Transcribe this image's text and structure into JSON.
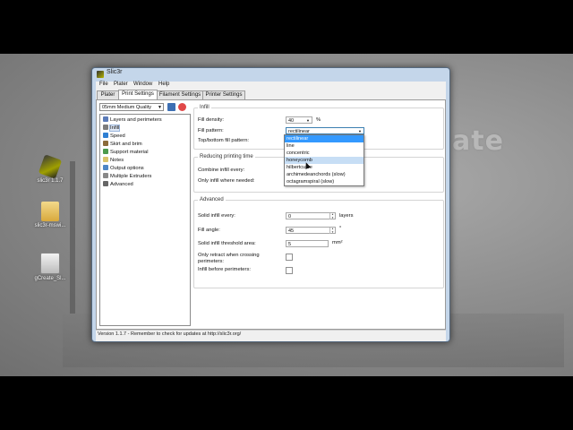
{
  "window": {
    "title": "Slic3r",
    "menu": [
      "File",
      "Plater",
      "Window",
      "Help"
    ],
    "tabs": [
      "Plater",
      "Print Settings",
      "Filament Settings",
      "Printer Settings"
    ],
    "active_tab": "Print Settings",
    "status": "Version 1.1.7 - Remember to check for updates at http://slic3r.org/"
  },
  "preset": {
    "value": "05mm Medium Quality"
  },
  "sidebar": {
    "items": [
      {
        "label": "Layers and perimeters",
        "icon": "layers-icon",
        "color": "#5b7bb8"
      },
      {
        "label": "Infill",
        "icon": "infill-icon",
        "color": "#7c7c7c"
      },
      {
        "label": "Speed",
        "icon": "speed-icon",
        "color": "#2f7fd3"
      },
      {
        "label": "Skirt and brim",
        "icon": "skirt-icon",
        "color": "#8b6b3a"
      },
      {
        "label": "Support material",
        "icon": "support-icon",
        "color": "#4c9a4c"
      },
      {
        "label": "Notes",
        "icon": "notes-icon",
        "color": "#d9c36a"
      },
      {
        "label": "Output options",
        "icon": "output-icon",
        "color": "#4e86c6"
      },
      {
        "label": "Multiple Extruders",
        "icon": "extruders-icon",
        "color": "#888888"
      },
      {
        "label": "Advanced",
        "icon": "wrench-icon",
        "color": "#666666"
      }
    ],
    "selected": "Infill"
  },
  "infill": {
    "title": "Infill",
    "fill_density_label": "Fill density:",
    "fill_density_value": "40",
    "fill_density_unit": "%",
    "fill_pattern_label": "Fill pattern:",
    "fill_pattern_value": "rectilinear",
    "top_bottom_label": "Top/bottom fill pattern:"
  },
  "dropdown": {
    "options": [
      "rectilinear",
      "line",
      "concentric",
      "honeycomb",
      "hilbertcurve",
      "archimedeanchords (slow)",
      "octagramspiral (slow)"
    ],
    "highlighted": "rectilinear",
    "hovered": "honeycomb"
  },
  "reducing": {
    "title": "Reducing printing time",
    "combine_label": "Combine infill every:",
    "only_infill_label": "Only infill where needed:"
  },
  "advanced": {
    "title": "Advanced",
    "solid_every_label": "Solid infill every:",
    "solid_every_value": "0",
    "solid_every_unit": "layers",
    "fill_angle_label": "Fill angle:",
    "fill_angle_value": "45",
    "fill_angle_unit": "°",
    "threshold_label": "Solid infill threshold area:",
    "threshold_value": "5",
    "threshold_unit": "mm²",
    "retract_label": "Only retract when crossing perimeters:",
    "before_label": "Infill before perimeters:"
  },
  "desktop": {
    "icons": [
      {
        "label": "slic3r 1.1.7",
        "icon": "slic3r-app-icon"
      },
      {
        "label": "slic3r-mswi...",
        "icon": "folder-icon"
      },
      {
        "label": "gCreate_Sl...",
        "icon": "config-file-icon"
      }
    ],
    "watermark": "ate",
    "logo": "brand-logo-icon"
  }
}
